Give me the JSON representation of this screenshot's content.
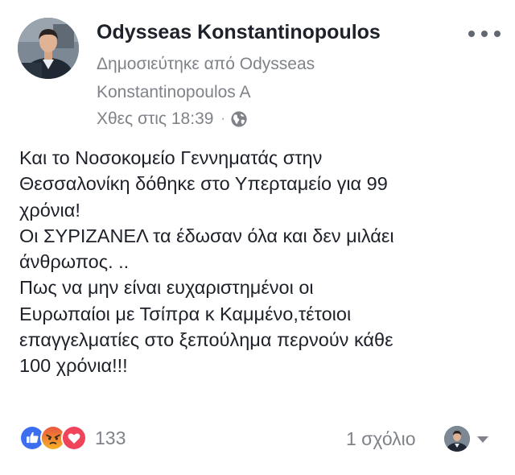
{
  "post": {
    "author": "Odysseas Konstantinopoulos",
    "published_by_line1": "Δημοσιεύτηκε από Odysseas",
    "published_by_line2": "Konstantinopoulos A",
    "timestamp": "Χθες στις 18:39",
    "separator": "·",
    "audience_icon": "globe-icon",
    "more_icon": "more-options-icon",
    "body_lines": [
      "Και το Νοσοκομείο Γεννηματάς στην",
      "Θεσσαλονίκη δόθηκε στο Υπερταμείο για 99",
      "χρόνια!",
      "Οι ΣΥΡΙΖΑΝΕΛ τα έδωσαν όλα και δεν μιλάει",
      "άνθρωπος. ..",
      "Πως να μην είναι ευχαριστημένοι οι",
      "Ευρωπαίοι με Τσίπρα κ Καμμένο,τέτοιοι",
      "επαγγελματίες στο ξεπούλημα περνούν κάθε",
      "100 χρόνια!!!"
    ]
  },
  "footer": {
    "reactions": [
      "like",
      "angry",
      "love"
    ],
    "reaction_count": "133",
    "comment_count": "1 σχόλιο"
  },
  "colors": {
    "text": "#1d2129",
    "secondary_text": "#7f8389",
    "like_blue": "#3b6ff0",
    "angry_orange": "#f7b125",
    "love_red": "#f0445a"
  }
}
